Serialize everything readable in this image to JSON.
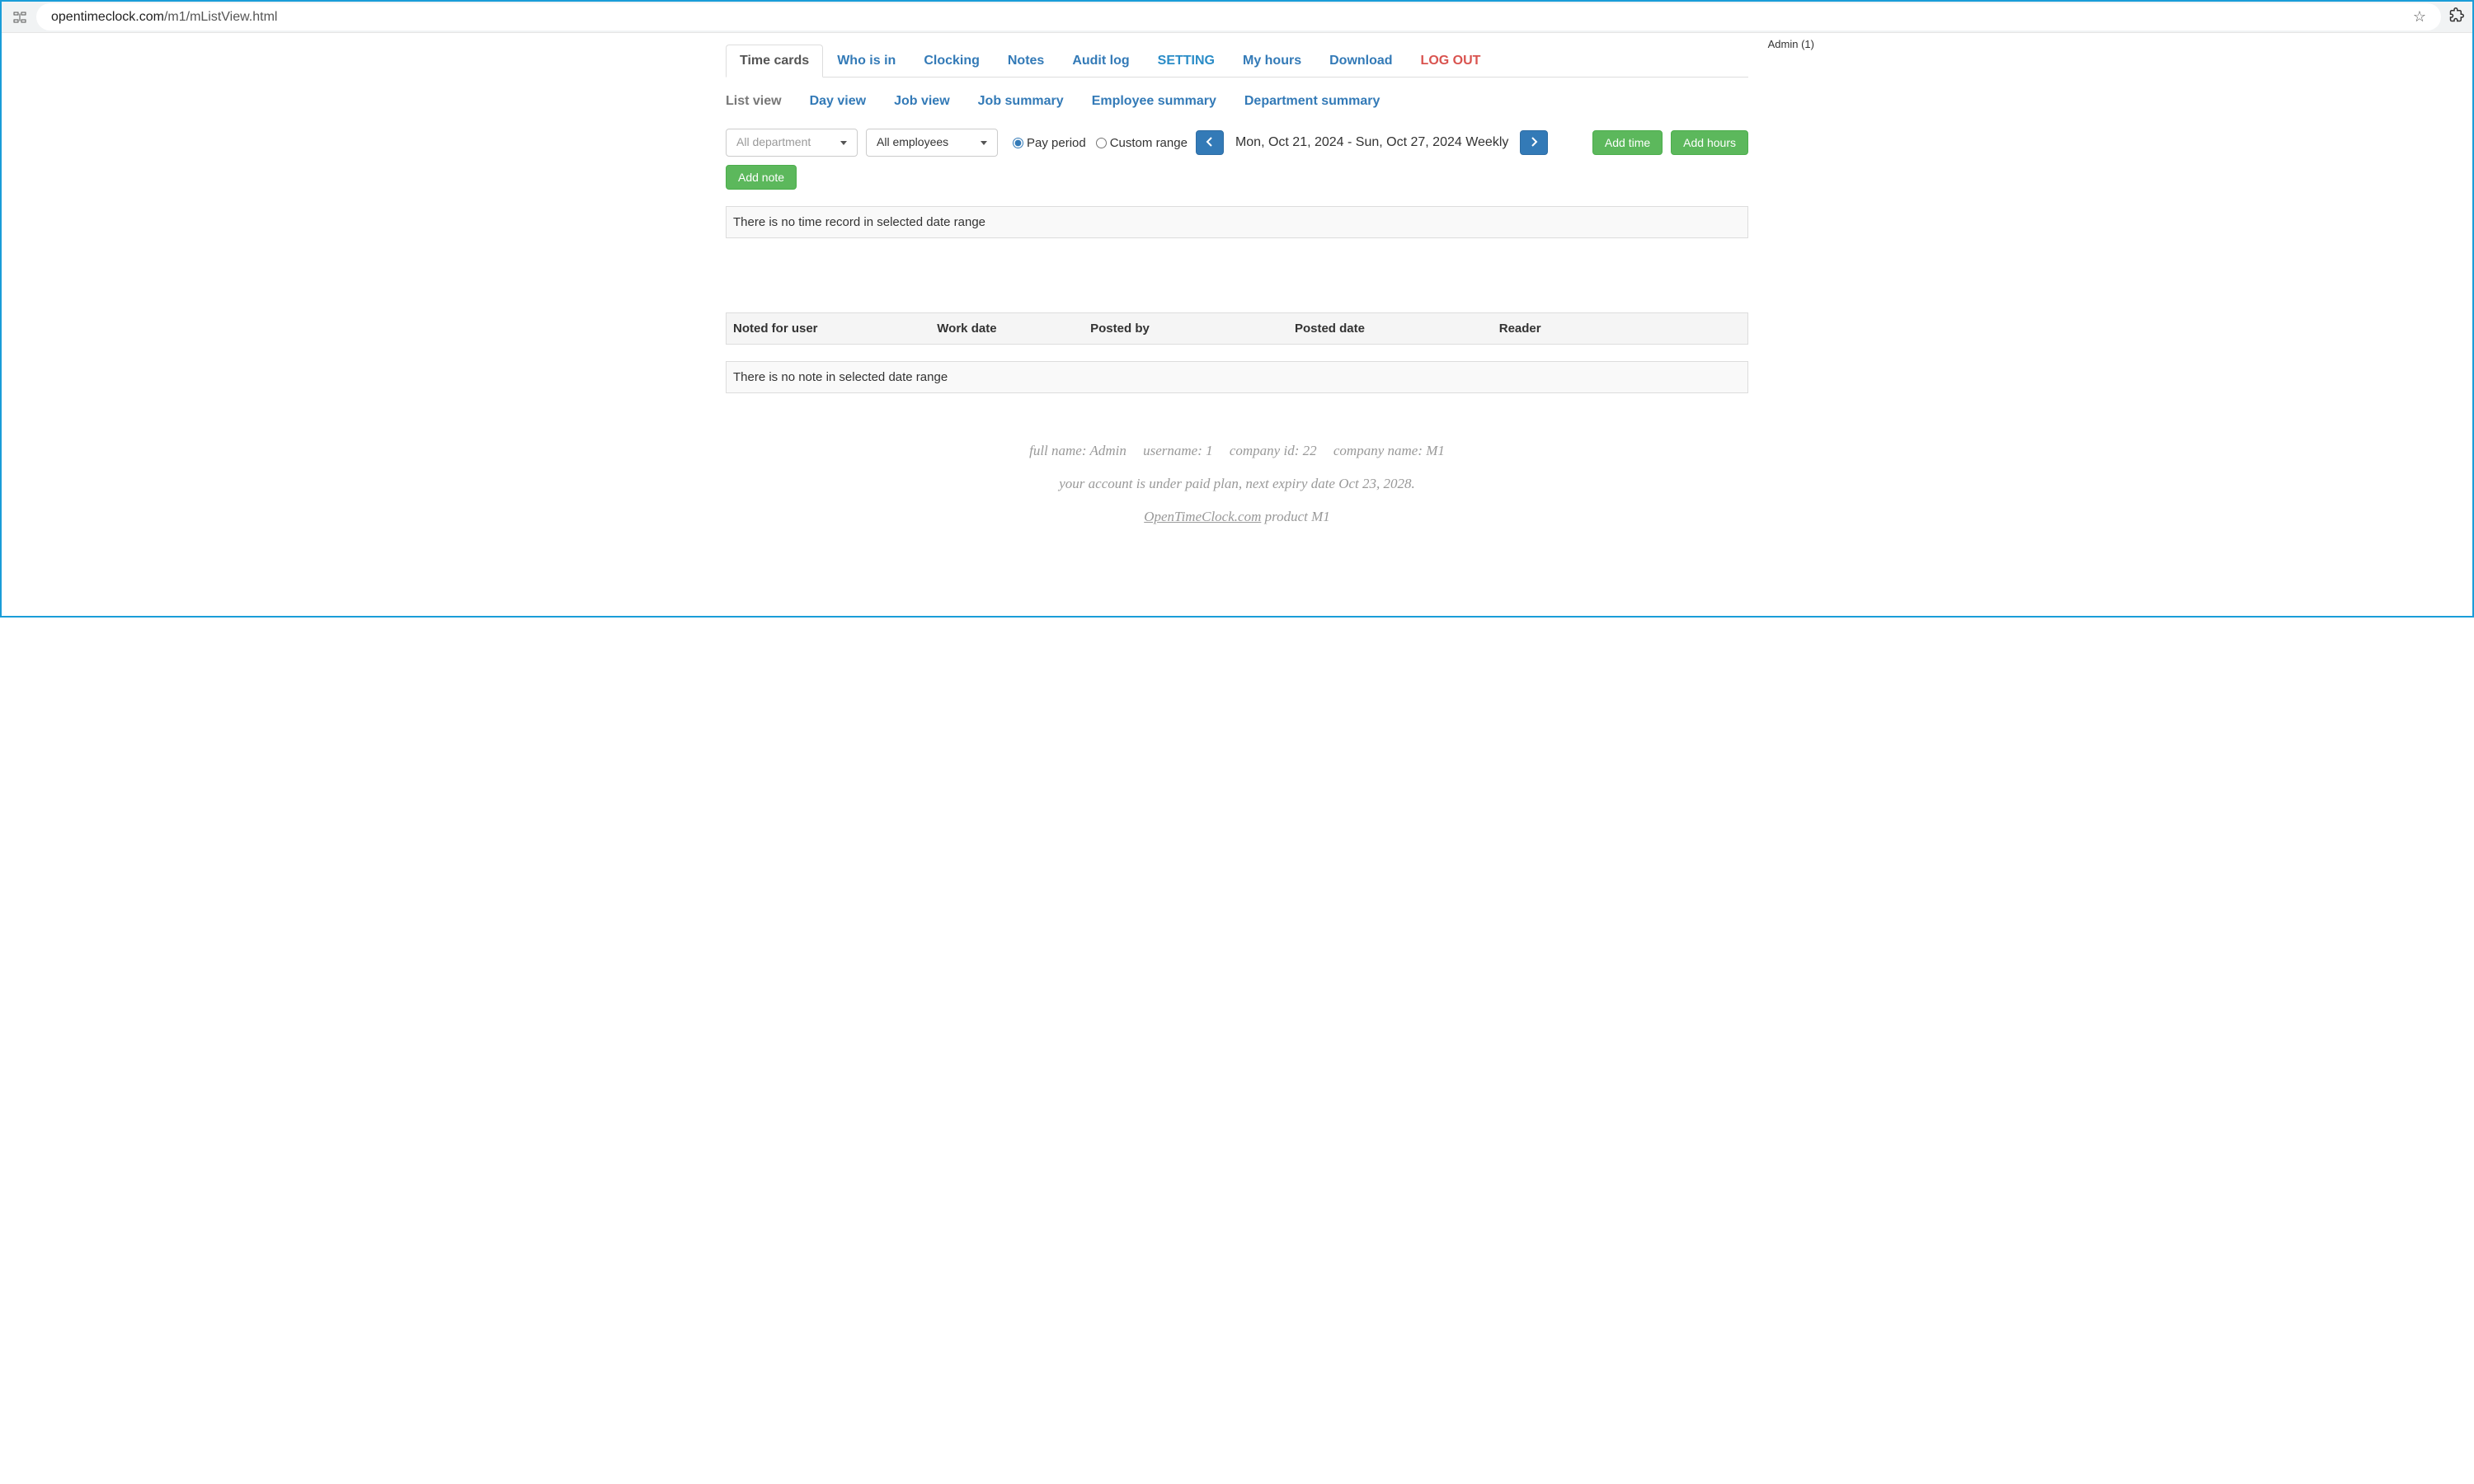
{
  "browser": {
    "url_host": "opentimeclock.com",
    "url_path": "/m1/mListView.html"
  },
  "header": {
    "user_label": "Admin (1)"
  },
  "nav_primary": [
    {
      "label": "Time cards",
      "active": true
    },
    {
      "label": "Who is in"
    },
    {
      "label": "Clocking"
    },
    {
      "label": "Notes"
    },
    {
      "label": "Audit log"
    },
    {
      "label": "SETTING"
    },
    {
      "label": "My hours"
    },
    {
      "label": "Download"
    },
    {
      "label": "LOG OUT",
      "red": true
    }
  ],
  "nav_secondary": [
    {
      "label": "List view",
      "active": true
    },
    {
      "label": "Day view"
    },
    {
      "label": "Job view"
    },
    {
      "label": "Job summary"
    },
    {
      "label": "Employee summary"
    },
    {
      "label": "Department summary"
    }
  ],
  "toolbar": {
    "department_select": "All department",
    "employee_select": "All employees",
    "radio_pay_period": "Pay period",
    "radio_custom_range": "Custom range",
    "date_range": "Mon, Oct 21, 2024 - Sun, Oct 27, 2024 Weekly",
    "btn_add_time": "Add time",
    "btn_add_hours": "Add hours",
    "btn_add_note": "Add note"
  },
  "time_table": {
    "empty_message": "There is no time record in selected date range"
  },
  "notes_table": {
    "headers": [
      "Noted for user",
      "Work date",
      "Posted by",
      "Posted date",
      "Reader"
    ],
    "empty_message": "There is no note in selected date range"
  },
  "footer": {
    "full_name_label": "full name:",
    "full_name": "Admin",
    "username_label": "username:",
    "username": "1",
    "company_id_label": "company id:",
    "company_id": "22",
    "company_name_label": "company name:",
    "company_name": "M1",
    "plan_line": "your account is under paid plan, next expiry date Oct 23, 2028.",
    "product_link": "OpenTimeClock.com",
    "product_suffix": " product M1"
  }
}
